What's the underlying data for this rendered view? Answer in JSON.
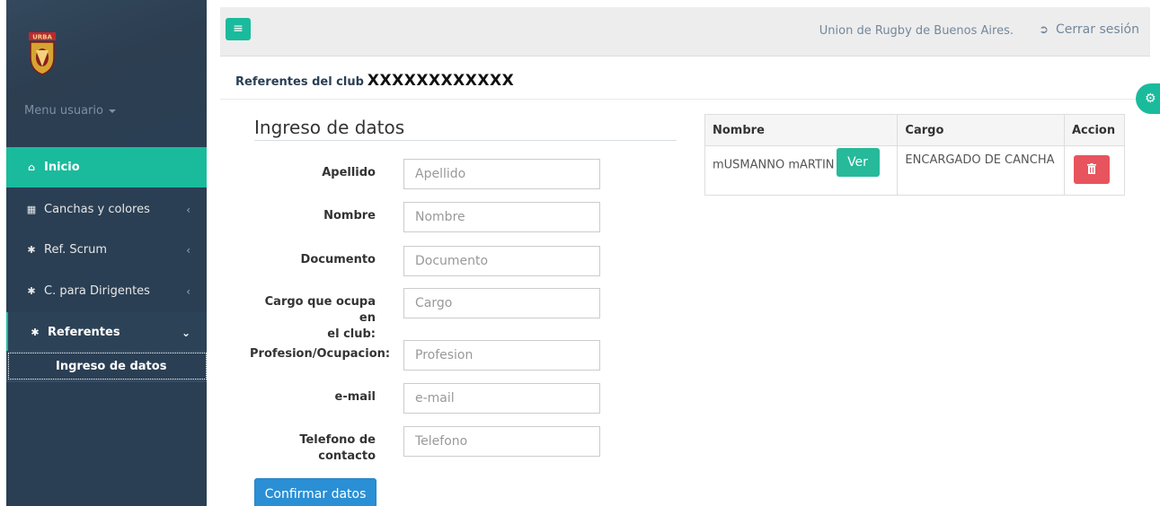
{
  "sidebar": {
    "logo_text": "URBA",
    "menu_user": "Menu usuario",
    "items": [
      {
        "label": "Inicio",
        "icon": "home-icon"
      },
      {
        "label": "Canchas y colores",
        "icon": "table-icon"
      },
      {
        "label": "Ref. Scrum",
        "icon": "gear-icon"
      },
      {
        "label": "C. para Dirigentes",
        "icon": "gear-icon"
      },
      {
        "label": "Referentes",
        "icon": "gear-icon"
      }
    ],
    "sub_item": "Ingreso de datos"
  },
  "topnav": {
    "org_name": "Union de Rugby de Buenos Aires.",
    "logout": "Cerrar sesión"
  },
  "page": {
    "heading_prefix": "Referentes del club",
    "club_name": "XXXXXXXXXXXX"
  },
  "form": {
    "title": "Ingreso de datos",
    "fields": [
      {
        "label": "Apellido",
        "placeholder": "Apellido"
      },
      {
        "label": "Nombre",
        "placeholder": "Nombre"
      },
      {
        "label": "Documento",
        "placeholder": "Documento"
      },
      {
        "label_line1": "Cargo que ocupa en",
        "label_line2": "el club:",
        "placeholder": "Cargo"
      },
      {
        "label": "Profesion/Ocupacion:",
        "placeholder": "Profesion"
      },
      {
        "label": "e-mail",
        "placeholder": "e-mail"
      },
      {
        "label_line1": "Telefono de",
        "label_line2": "contacto",
        "placeholder": "Telefono"
      }
    ],
    "submit": "Confirmar datos"
  },
  "table": {
    "headers": [
      "Nombre",
      "Cargo",
      "Accion"
    ],
    "rows": [
      {
        "nombre": "mUSMANNO mARTIN",
        "ver": "Ver",
        "cargo": "ENCARGADO DE CANCHA"
      }
    ]
  },
  "colors": {
    "sidebar": "#2a3f54",
    "accent": "#1abb9c",
    "primary_button": "#2a8fd4",
    "danger_button": "#e8545e"
  }
}
